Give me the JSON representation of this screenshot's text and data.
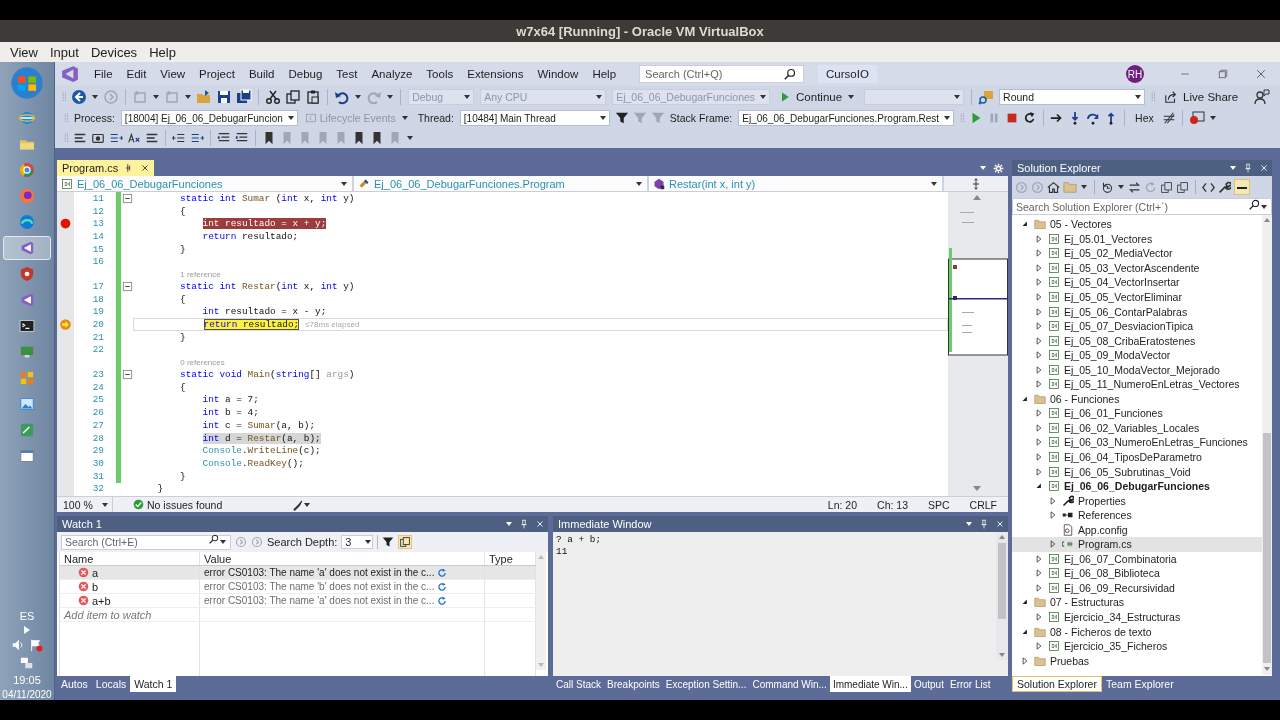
{
  "host": {
    "title": "w7x64 [Running] - Oracle VM VirtualBox",
    "menus": [
      "View",
      "Input",
      "Devices",
      "Help"
    ]
  },
  "taskbar": {
    "apps": [
      {
        "kind": "start",
        "selected": false
      },
      {
        "kind": "globe",
        "selected": false
      },
      {
        "kind": "folder",
        "selected": false
      },
      {
        "kind": "wheel",
        "selected": false
      },
      {
        "kind": "fox",
        "selected": false
      },
      {
        "kind": "wave",
        "selected": false
      },
      {
        "kind": "studio",
        "selected": true
      },
      {
        "kind": "shield",
        "selected": false
      },
      {
        "kind": "studio",
        "selected": false
      },
      {
        "kind": "terminal",
        "selected": false
      },
      {
        "kind": "monitor",
        "selected": false
      },
      {
        "kind": "grid",
        "selected": false
      },
      {
        "kind": "image",
        "selected": false
      },
      {
        "kind": "tool",
        "selected": false
      },
      {
        "kind": "window",
        "selected": false
      }
    ],
    "language": "ES",
    "time": "19:05",
    "date": "04/11/2020"
  },
  "vs": {
    "menus": [
      "File",
      "Edit",
      "View",
      "Project",
      "Build",
      "Debug",
      "Test",
      "Analyze",
      "Tools",
      "Extensions",
      "Window",
      "Help"
    ],
    "search_placeholder": "Search (Ctrl+Q)",
    "solution": "CursoIO",
    "user": "RH",
    "live_share": "Live Share"
  },
  "toolbar": {
    "configuration": {
      "value": "Debug",
      "disabled": true
    },
    "platform": {
      "value": "Any CPU",
      "disabled": true
    },
    "startup": {
      "value": "Ej_06_06_DebugarFunciones",
      "disabled": true
    },
    "continue": "Continue",
    "find": "Round",
    "process_label": "Process:",
    "process": "[18004] Ej_06_06_DebugarFuncion",
    "lifecycle": {
      "value": "Lifecycle Events",
      "disabled": true
    },
    "thread_label": "Thread:",
    "thread": "[10484] Main Thread",
    "stack_frame_label": "Stack Frame:",
    "stack_frame": "Ej_06_06_DebugarFunciones.Program.Rest",
    "hex": "Hex"
  },
  "editor": {
    "tab": "Program.cs",
    "nav": [
      "Ej_06_06_DebugarFunciones",
      "Ej_06_06_DebugarFunciones.Program",
      "Restar(int x, int y)"
    ],
    "lines": [
      {
        "kind": "code",
        "number": "11",
        "fold": true,
        "tokens": [
          {
            "kind": "keyword",
            "text": "        static int"
          },
          {
            "kind": "method",
            "text": " Sumar"
          },
          {
            "kind": "plain",
            "text": " ("
          },
          {
            "kind": "keyword",
            "text": "int"
          },
          {
            "kind": "plain",
            "text": " x, "
          },
          {
            "kind": "keyword",
            "text": "int"
          },
          {
            "kind": "plain",
            "text": " y)"
          }
        ]
      },
      {
        "kind": "code",
        "number": "12",
        "fold": false,
        "tokens": [
          {
            "kind": "plain",
            "text": "        {"
          }
        ]
      },
      {
        "kind": "breakpoint",
        "number": "13",
        "fold": false,
        "tokens": [
          {
            "kind": "keyword",
            "text": "            int"
          },
          {
            "kind": "plain",
            "text": " resultado = x + y;"
          }
        ]
      },
      {
        "kind": "code",
        "number": "14",
        "fold": false,
        "tokens": [
          {
            "kind": "keyword",
            "text": "            return"
          },
          {
            "kind": "plain",
            "text": " resultado;"
          }
        ]
      },
      {
        "kind": "code",
        "number": "15",
        "fold": false,
        "tokens": [
          {
            "kind": "plain",
            "text": "        }"
          }
        ]
      },
      {
        "kind": "code",
        "number": "16",
        "fold": false
      },
      {
        "kind": "lens",
        "text": "1 reference"
      },
      {
        "kind": "code",
        "number": "17",
        "fold": true,
        "tokens": [
          {
            "kind": "keyword",
            "text": "        static int"
          },
          {
            "kind": "method",
            "text": " Restar"
          },
          {
            "kind": "plain",
            "text": "("
          },
          {
            "kind": "keyword",
            "text": "int"
          },
          {
            "kind": "plain",
            "text": " x, "
          },
          {
            "kind": "keyword",
            "text": "int"
          },
          {
            "kind": "plain",
            "text": " y)"
          }
        ]
      },
      {
        "kind": "code",
        "number": "18",
        "fold": false,
        "tokens": [
          {
            "kind": "plain",
            "text": "        {"
          }
        ]
      },
      {
        "kind": "code",
        "number": "19",
        "fold": false,
        "tokens": [
          {
            "kind": "keyword",
            "text": "            int"
          },
          {
            "kind": "plain",
            "text": " resultado = x - y;"
          }
        ]
      },
      {
        "kind": "current",
        "number": "20",
        "fold": false,
        "tip": "≤78ms elapsed",
        "tokens": [
          {
            "kind": "keyword",
            "text": "            return"
          },
          {
            "kind": "plain",
            "text": " resultado;"
          }
        ]
      },
      {
        "kind": "code",
        "number": "21",
        "fold": false,
        "tokens": [
          {
            "kind": "plain",
            "text": "        }"
          }
        ]
      },
      {
        "kind": "code",
        "number": "22",
        "fold": false
      },
      {
        "kind": "lens",
        "text": "0 references"
      },
      {
        "kind": "code",
        "number": "23",
        "fold": true,
        "tokens": [
          {
            "kind": "keyword",
            "text": "        static void"
          },
          {
            "kind": "method",
            "text": " Main"
          },
          {
            "kind": "plain",
            "text": "("
          },
          {
            "kind": "keyword",
            "text": "string"
          },
          {
            "kind": "plain",
            "text": "[] "
          },
          {
            "kind": "unused",
            "text": "args"
          },
          {
            "kind": "plain",
            "text": ")"
          }
        ]
      },
      {
        "kind": "code",
        "number": "24",
        "fold": false,
        "tokens": [
          {
            "kind": "plain",
            "text": "        {"
          }
        ]
      },
      {
        "kind": "code",
        "number": "25",
        "fold": false,
        "tokens": [
          {
            "kind": "keyword",
            "text": "            int"
          },
          {
            "kind": "plain",
            "text": " a = 7;"
          }
        ]
      },
      {
        "kind": "code",
        "number": "26",
        "fold": false,
        "tokens": [
          {
            "kind": "keyword",
            "text": "            int"
          },
          {
            "kind": "plain",
            "text": " b = 4;"
          }
        ]
      },
      {
        "kind": "code",
        "number": "27",
        "fold": false,
        "tokens": [
          {
            "kind": "keyword",
            "text": "            int"
          },
          {
            "kind": "plain",
            "text": " c = "
          },
          {
            "kind": "method",
            "text": "Sumar"
          },
          {
            "kind": "plain",
            "text": "(a, b);"
          }
        ]
      },
      {
        "kind": "frame",
        "number": "28",
        "fold": false,
        "tokens": [
          {
            "kind": "keyword",
            "text": "            int"
          },
          {
            "kind": "plain",
            "text": " d = "
          },
          {
            "kind": "method",
            "text": "Restar"
          },
          {
            "kind": "plain",
            "text": "(a, b);"
          }
        ]
      },
      {
        "kind": "code",
        "number": "29",
        "fold": false,
        "tokens": [
          {
            "kind": "type",
            "text": "            Console"
          },
          {
            "kind": "plain",
            "text": "."
          },
          {
            "kind": "method",
            "text": "WriteLine"
          },
          {
            "kind": "plain",
            "text": "(c);"
          }
        ]
      },
      {
        "kind": "code",
        "number": "30",
        "fold": false,
        "tokens": [
          {
            "kind": "type",
            "text": "            Console"
          },
          {
            "kind": "plain",
            "text": "."
          },
          {
            "kind": "method",
            "text": "ReadKey"
          },
          {
            "kind": "plain",
            "text": "();"
          }
        ]
      },
      {
        "kind": "code",
        "number": "31",
        "fold": false,
        "tokens": [
          {
            "kind": "plain",
            "text": "        }"
          }
        ]
      },
      {
        "kind": "code",
        "number": "32",
        "fold": false,
        "tokens": [
          {
            "kind": "plain",
            "text": "    }"
          }
        ]
      }
    ],
    "zoom": "100 %",
    "issues": "No issues found",
    "ln": "Ln: 20",
    "ch": "Ch: 13",
    "spc": "SPC",
    "crlf": "CRLF"
  },
  "watch": {
    "title": "Watch 1",
    "search_placeholder": "Search (Ctrl+E)",
    "depth_label": "Search Depth:",
    "depth": "3",
    "columns": [
      "Name",
      "Value",
      "Type"
    ],
    "rows": [
      {
        "name": "a",
        "value": "error CS0103: The name 'a' does not exist in the c...",
        "selected": true
      },
      {
        "name": "b",
        "value": "error CS0103: The name 'b' does not exist in the c...",
        "selected": false
      },
      {
        "name": "a+b",
        "value": "error CS0103: The name 'a' does not exist in the c...",
        "selected": false
      }
    ],
    "add_placeholder": "Add item to watch",
    "tabs": [
      {
        "label": "Autos",
        "selected": false
      },
      {
        "label": "Locals",
        "selected": false
      },
      {
        "label": "Watch 1",
        "selected": true
      }
    ]
  },
  "immediate": {
    "title": "Immediate Window",
    "lines": [
      "? a + b;",
      "11"
    ],
    "tabs": [
      {
        "label": "Call Stack",
        "selected": false
      },
      {
        "label": "Breakpoints",
        "selected": false
      },
      {
        "label": "Exception Settin...",
        "selected": false
      },
      {
        "label": "Command Win...",
        "selected": false
      },
      {
        "label": "Immediate Win...",
        "selected": true
      },
      {
        "label": "Output",
        "selected": false
      },
      {
        "label": "Error List",
        "selected": false
      }
    ]
  },
  "solution_explorer": {
    "title": "Solution Explorer",
    "search_placeholder": "Search Solution Explorer (Ctrl+´)",
    "tree": [
      {
        "label": "05 - Vectores",
        "kind": "folder",
        "expanded": true,
        "selected": false,
        "children": [
          {
            "label": "Ej_05.01_Vectores",
            "kind": "project",
            "expanded": false,
            "selected": false
          },
          {
            "label": "Ej_05_02_MediaVector",
            "kind": "project",
            "expanded": false,
            "selected": false
          },
          {
            "label": "Ej_05_03_VectorAscendente",
            "kind": "project",
            "expanded": false,
            "selected": false
          },
          {
            "label": "Ej_05_04_VectorInsertar",
            "kind": "project",
            "expanded": false,
            "selected": false
          },
          {
            "label": "Ej_05_05_VectorEliminar",
            "kind": "project",
            "expanded": false,
            "selected": false
          },
          {
            "label": "Ej_05_06_ContarPalabras",
            "kind": "project",
            "expanded": false,
            "selected": false
          },
          {
            "label": "Ej_05_07_DesviacionTipica",
            "kind": "project",
            "expanded": false,
            "selected": false
          },
          {
            "label": "Ej_05_08_CribaEratostenes",
            "kind": "project",
            "expanded": false,
            "selected": false
          },
          {
            "label": "Ej_05_09_ModaVector",
            "kind": "project",
            "expanded": false,
            "selected": false
          },
          {
            "label": "Ej_05_10_ModaVector_Mejorado",
            "kind": "project",
            "expanded": false,
            "selected": false
          },
          {
            "label": "Ej_05_11_NumeroEnLetras_Vectores",
            "kind": "project",
            "expanded": false,
            "selected": false
          }
        ]
      },
      {
        "label": "06 - Funciones",
        "kind": "folder",
        "expanded": true,
        "selected": false,
        "children": [
          {
            "label": "Ej_06_01_Funciones",
            "kind": "project",
            "expanded": false,
            "selected": false
          },
          {
            "label": "Ej_06_02_Variables_Locales",
            "kind": "project",
            "expanded": false,
            "selected": false
          },
          {
            "label": "Ej_06_03_NumeroEnLetras_Funciones",
            "kind": "project",
            "expanded": false,
            "selected": false
          },
          {
            "label": "Ej_06_04_TiposDeParametro",
            "kind": "project",
            "expanded": false,
            "selected": false
          },
          {
            "label": "Ej_06_05_Subrutinas_Void",
            "kind": "project",
            "expanded": false,
            "selected": false
          },
          {
            "label": "Ej_06_06_DebugarFunciones",
            "kind": "startup_project",
            "expanded": true,
            "selected": false,
            "children": [
              {
                "label": "Properties",
                "kind": "properties",
                "expanded": false,
                "selected": false
              },
              {
                "label": "References",
                "kind": "references",
                "expanded": false,
                "selected": false
              },
              {
                "label": "App.config",
                "kind": "config",
                "selected": false
              },
              {
                "label": "Program.cs",
                "kind": "csharp_file",
                "expanded": false,
                "selected": true
              }
            ]
          },
          {
            "label": "Ej_06_07_Combinatoria",
            "kind": "project",
            "expanded": false,
            "selected": false
          },
          {
            "label": "Ej_06_08_Biblioteca",
            "kind": "project",
            "expanded": false,
            "selected": false
          },
          {
            "label": "Ej_06_09_Recursividad",
            "kind": "project",
            "expanded": false,
            "selected": false
          }
        ]
      },
      {
        "label": "07 - Estructuras",
        "kind": "folder",
        "expanded": true,
        "selected": false,
        "children": [
          {
            "label": "Ejercicio_34_Estructuras",
            "kind": "project",
            "expanded": false,
            "selected": false
          }
        ]
      },
      {
        "label": "08 - Ficheros de texto",
        "kind": "folder",
        "expanded": true,
        "selected": false,
        "children": [
          {
            "label": "Ejercicio_35_Ficheros",
            "kind": "project",
            "expanded": false,
            "selected": false
          }
        ]
      },
      {
        "label": "Pruebas",
        "kind": "folder",
        "expanded": false,
        "selected": false
      }
    ],
    "tabs": [
      {
        "label": "Solution Explorer",
        "selected": true
      },
      {
        "label": "Team Explorer",
        "selected": false
      }
    ]
  }
}
